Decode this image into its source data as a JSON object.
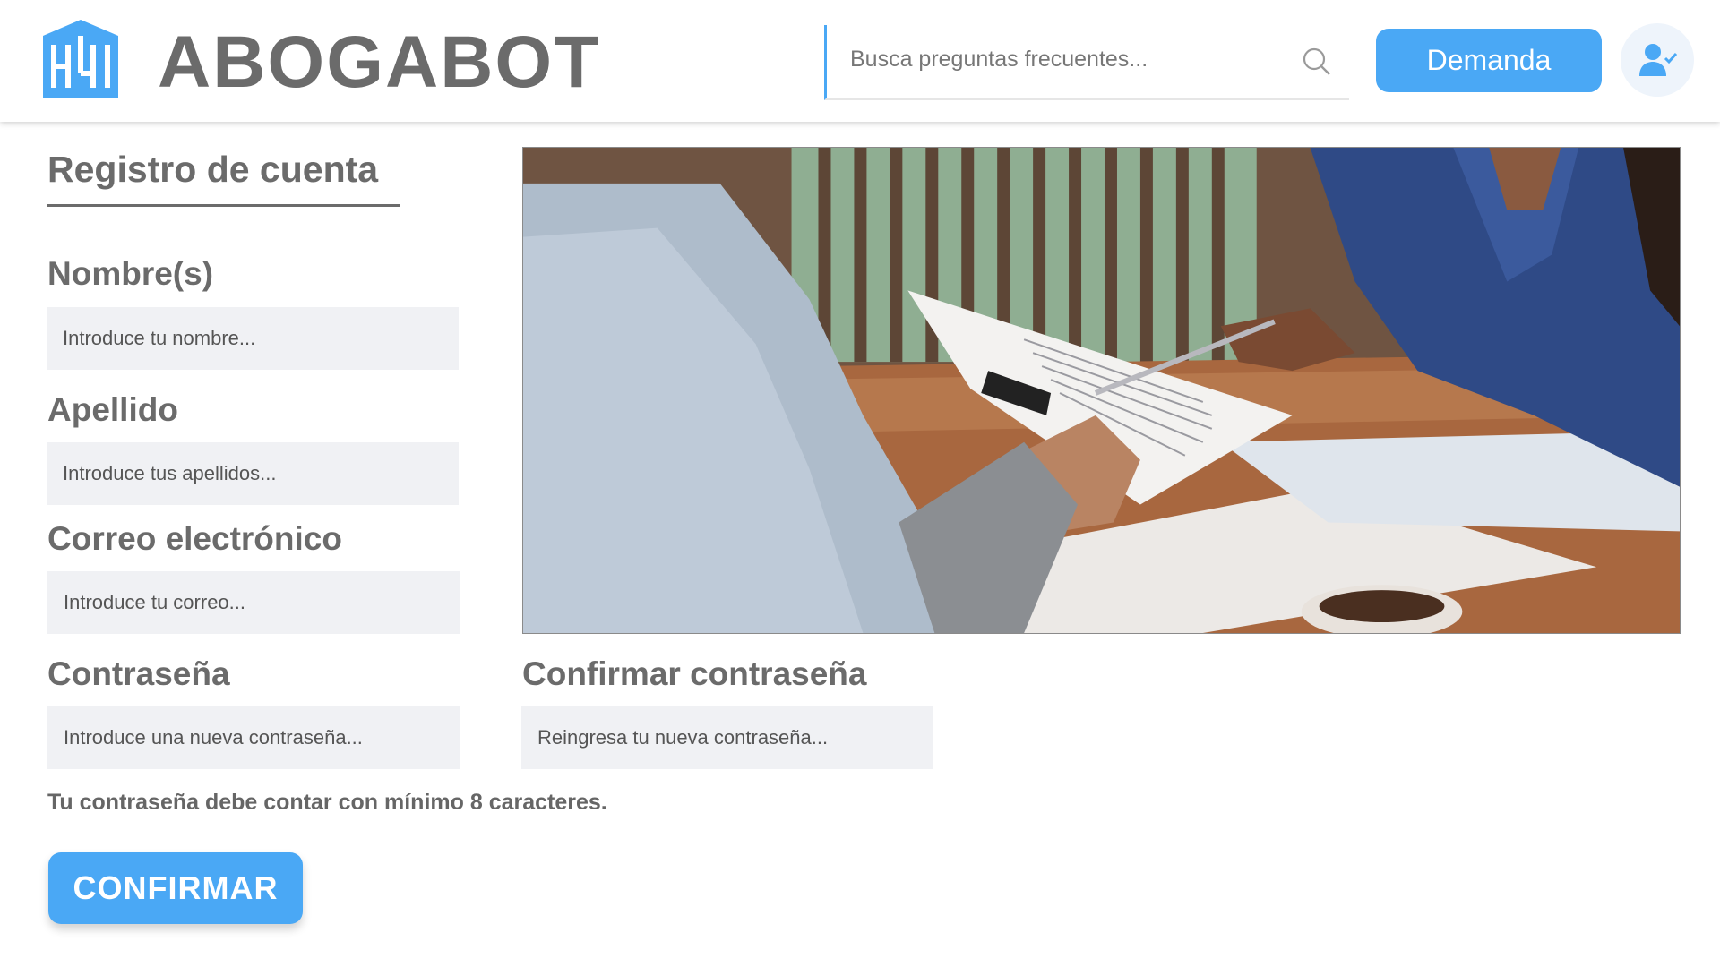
{
  "header": {
    "brand": "ABOGABOT",
    "search_placeholder": "Busca preguntas frecuentes...",
    "demanda_label": "Demanda"
  },
  "form": {
    "title": "Registro de cuenta",
    "fields": {
      "nombre": {
        "label": "Nombre(s)",
        "placeholder": "Introduce tu nombre..."
      },
      "apellido": {
        "label": "Apellido",
        "placeholder": "Introduce tus apellidos..."
      },
      "correo": {
        "label": "Correo electrónico",
        "placeholder": "Introduce tu correo..."
      },
      "contrasena": {
        "label": "Contraseña",
        "placeholder": "Introduce una nueva contraseña..."
      },
      "confirmar": {
        "label": "Confirmar contraseña",
        "placeholder": "Reingresa tu nueva contraseña..."
      }
    },
    "hint": "Tu contraseña debe contar con mínimo 8 caracteres.",
    "confirm_label": "CONFIRMAR"
  },
  "icons": {
    "logo": "building-logo-icon",
    "search": "search-icon",
    "user": "user-check-icon"
  },
  "colors": {
    "accent": "#4aa8f5",
    "text": "#6b6b6b",
    "field_bg": "#f0f1f4"
  }
}
